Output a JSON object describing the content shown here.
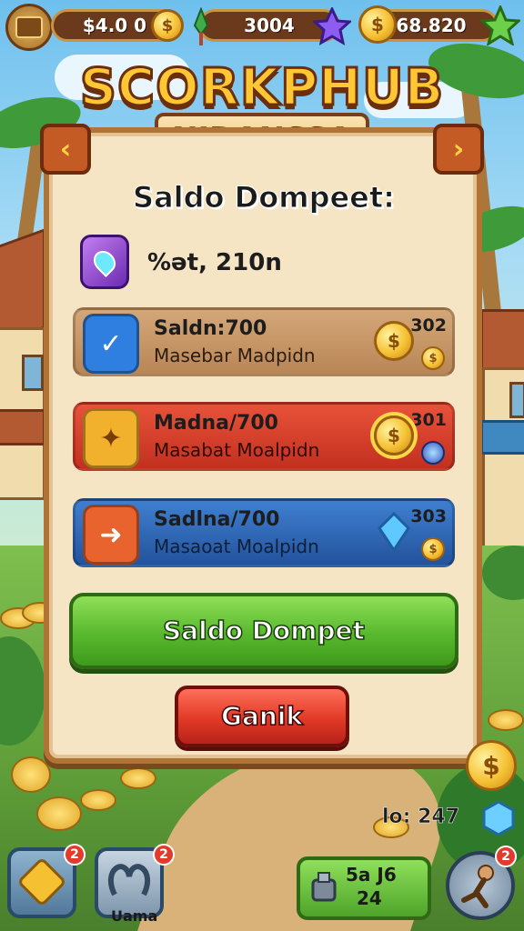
{
  "top_bar": {
    "money": "$4.0  0",
    "energy": "3004",
    "coins": "68.820"
  },
  "title": {
    "main": "SCORKPHUB",
    "sub": "NIDANSSA"
  },
  "nav": {
    "prev": "‹",
    "next": "›"
  },
  "panel": {
    "heading": "Saldo Dompeet:",
    "balance": "%ət, 210n",
    "cards": [
      {
        "title": "Saldn:700",
        "subtitle": "Masebar Madpidn",
        "count": "302",
        "color": "#c99565",
        "badge_color": "#2f7fe0",
        "badge_icon": "check-icon"
      },
      {
        "title": "Madna/700",
        "subtitle": "Masabat Moalpidn",
        "count": "301",
        "color": "#d84030",
        "badge_color": "#f2b12c",
        "badge_icon": "star-icon"
      },
      {
        "title": "Sadlna/700",
        "subtitle": "Masaoat Moalpidn",
        "count": "303",
        "color": "#2f66b6",
        "badge_color": "#e8632d",
        "badge_icon": "arrow-icon"
      }
    ],
    "primary_button": "Saldo Dompet",
    "secondary_button": "Ganik"
  },
  "bottom_bar": {
    "tile1_badge": "2",
    "tile2_badge": "2",
    "tile2_label": "Uama",
    "side_stat": "lo: 247",
    "green_line1": "5a J6",
    "green_line2": "24",
    "right_badge": "2"
  },
  "colors": {
    "wood": "#b27336",
    "parchment": "#f6e5c4",
    "gold": "#f5c133",
    "green_button": "#58b82d",
    "red_button": "#e03a26"
  }
}
